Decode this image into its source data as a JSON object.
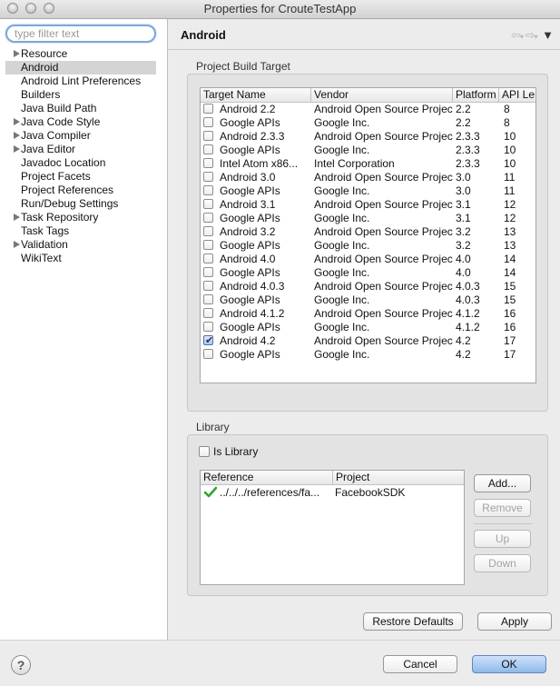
{
  "window": {
    "title": "Properties for CrouteTestApp"
  },
  "filter": {
    "placeholder": "type filter text",
    "value": ""
  },
  "tree": [
    {
      "label": "Resource",
      "expandable": true,
      "selected": false
    },
    {
      "label": "Android",
      "expandable": false,
      "selected": true
    },
    {
      "label": "Android Lint Preferences",
      "expandable": false,
      "selected": false
    },
    {
      "label": "Builders",
      "expandable": false,
      "selected": false
    },
    {
      "label": "Java Build Path",
      "expandable": false,
      "selected": false
    },
    {
      "label": "Java Code Style",
      "expandable": true,
      "selected": false
    },
    {
      "label": "Java Compiler",
      "expandable": true,
      "selected": false
    },
    {
      "label": "Java Editor",
      "expandable": true,
      "selected": false
    },
    {
      "label": "Javadoc Location",
      "expandable": false,
      "selected": false
    },
    {
      "label": "Project Facets",
      "expandable": false,
      "selected": false
    },
    {
      "label": "Project References",
      "expandable": false,
      "selected": false
    },
    {
      "label": "Run/Debug Settings",
      "expandable": false,
      "selected": false
    },
    {
      "label": "Task Repository",
      "expandable": true,
      "selected": false
    },
    {
      "label": "Task Tags",
      "expandable": false,
      "selected": false
    },
    {
      "label": "Validation",
      "expandable": true,
      "selected": false
    },
    {
      "label": "WikiText",
      "expandable": false,
      "selected": false
    }
  ],
  "page": {
    "title": "Android"
  },
  "build_target": {
    "group_label": "Project Build Target",
    "columns": [
      "Target Name",
      "Vendor",
      "Platform",
      "API Le"
    ],
    "rows": [
      {
        "name": "Android 2.2",
        "vendor": "Android Open Source Project",
        "platform": "2.2",
        "api": "8",
        "checked": false
      },
      {
        "name": "Google APIs",
        "vendor": "Google Inc.",
        "platform": "2.2",
        "api": "8",
        "checked": false
      },
      {
        "name": "Android 2.3.3",
        "vendor": "Android Open Source Project",
        "platform": "2.3.3",
        "api": "10",
        "checked": false
      },
      {
        "name": "Google APIs",
        "vendor": "Google Inc.",
        "platform": "2.3.3",
        "api": "10",
        "checked": false
      },
      {
        "name": "Intel Atom x86...",
        "vendor": "Intel Corporation",
        "platform": "2.3.3",
        "api": "10",
        "checked": false
      },
      {
        "name": "Android 3.0",
        "vendor": "Android Open Source Project",
        "platform": "3.0",
        "api": "11",
        "checked": false
      },
      {
        "name": "Google APIs",
        "vendor": "Google Inc.",
        "platform": "3.0",
        "api": "11",
        "checked": false
      },
      {
        "name": "Android 3.1",
        "vendor": "Android Open Source Project",
        "platform": "3.1",
        "api": "12",
        "checked": false
      },
      {
        "name": "Google APIs",
        "vendor": "Google Inc.",
        "platform": "3.1",
        "api": "12",
        "checked": false
      },
      {
        "name": "Android 3.2",
        "vendor": "Android Open Source Project",
        "platform": "3.2",
        "api": "13",
        "checked": false
      },
      {
        "name": "Google APIs",
        "vendor": "Google Inc.",
        "platform": "3.2",
        "api": "13",
        "checked": false
      },
      {
        "name": "Android 4.0",
        "vendor": "Android Open Source Project",
        "platform": "4.0",
        "api": "14",
        "checked": false
      },
      {
        "name": "Google APIs",
        "vendor": "Google Inc.",
        "platform": "4.0",
        "api": "14",
        "checked": false
      },
      {
        "name": "Android 4.0.3",
        "vendor": "Android Open Source Project",
        "platform": "4.0.3",
        "api": "15",
        "checked": false
      },
      {
        "name": "Google APIs",
        "vendor": "Google Inc.",
        "platform": "4.0.3",
        "api": "15",
        "checked": false
      },
      {
        "name": "Android 4.1.2",
        "vendor": "Android Open Source Project",
        "platform": "4.1.2",
        "api": "16",
        "checked": false
      },
      {
        "name": "Google APIs",
        "vendor": "Google Inc.",
        "platform": "4.1.2",
        "api": "16",
        "checked": false
      },
      {
        "name": "Android 4.2",
        "vendor": "Android Open Source Project",
        "platform": "4.2",
        "api": "17",
        "checked": true
      },
      {
        "name": "Google APIs",
        "vendor": "Google Inc.",
        "platform": "4.2",
        "api": "17",
        "checked": false
      }
    ]
  },
  "library": {
    "group_label": "Library",
    "is_library_label": "Is Library",
    "is_library_checked": false,
    "columns": [
      "Reference",
      "Project"
    ],
    "rows": [
      {
        "reference": "../../../references/fa...",
        "project": "FacebookSDK",
        "status_icon": "green-check-icon"
      }
    ],
    "buttons": {
      "add": "Add...",
      "remove": "Remove",
      "up": "Up",
      "down": "Down"
    }
  },
  "actions": {
    "restore_defaults": "Restore Defaults",
    "apply": "Apply"
  },
  "dialog": {
    "help": "?",
    "cancel": "Cancel",
    "ok": "OK"
  }
}
